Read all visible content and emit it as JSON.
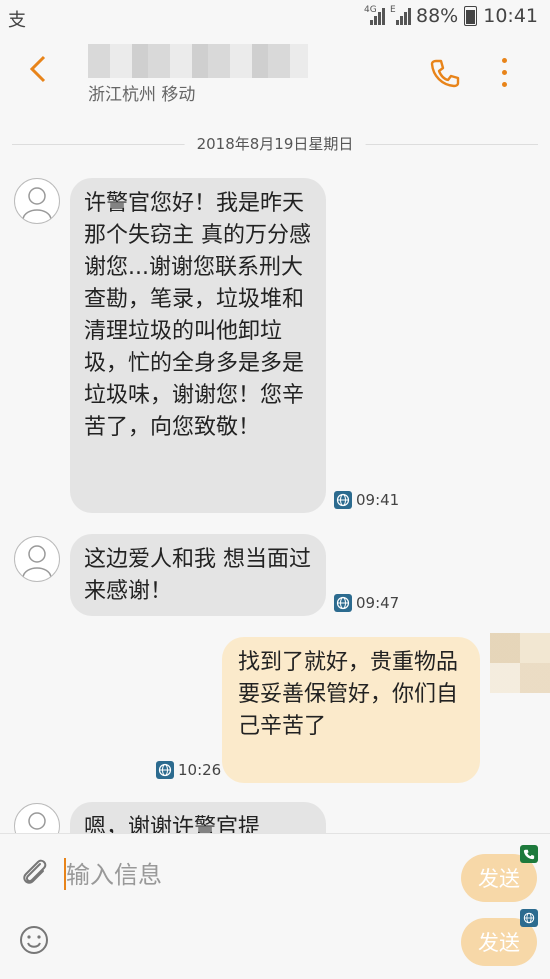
{
  "status": {
    "app_icon": "支",
    "network": "4G",
    "network_sub": "E",
    "battery": "88%",
    "time": "10:41"
  },
  "header": {
    "location": "浙江杭州 移动"
  },
  "date_divider": "2018年8月19日星期日",
  "messages": [
    {
      "text": "许警官您好！我是昨天那个失窃主 真的万分感谢您...谢谢您联系刑大查勘，笔录，垃圾堆和清理垃圾的叫他卸垃圾，忙的全身多是多是垃圾味，谢谢您！您辛苦了，向您致敬！",
      "time": "09:41"
    },
    {
      "text": "这边爱人和我 想当面过来感谢！",
      "time": "09:47"
    },
    {
      "text": "找到了就好，贵重物品要妥善保管好，你们自己辛苦了",
      "time": "10:26"
    },
    {
      "text": "嗯，谢谢许警官提"
    }
  ],
  "composer": {
    "placeholder": "输入信息",
    "send_label_1": "发送",
    "send_label_2": "发送"
  },
  "colors": {
    "accent": "#e8841a",
    "incoming": "#e4e4e4",
    "outgoing": "#fbeacb",
    "send": "#f7d8a8"
  }
}
